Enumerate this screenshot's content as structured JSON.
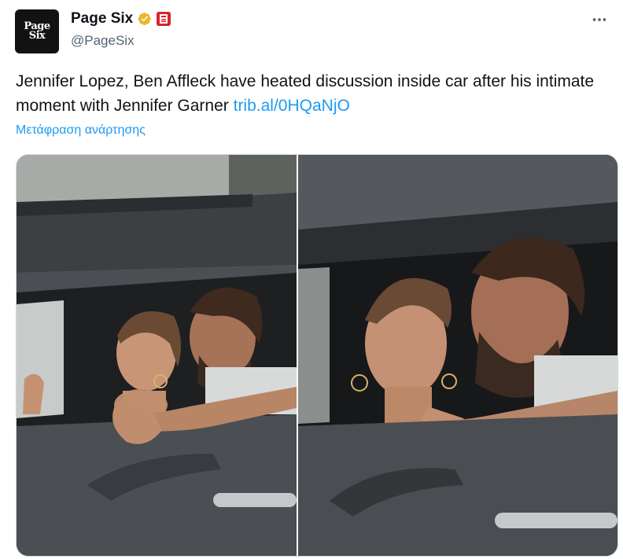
{
  "account": {
    "display_name": "Page Six",
    "handle": "@PageSix",
    "avatar_text_line1": "Page",
    "avatar_text_line2": "Six"
  },
  "tweet": {
    "text": "Jennifer Lopez, Ben Affleck have heated discussion inside car after his intimate moment with Jennifer Garner ",
    "link": "trib.al/0HQaNjO",
    "translate_label": "Μετάφραση ανάρτησης"
  },
  "icons": {
    "verified": "verified-gold-icon",
    "affiliate": "page-six-affiliate-badge",
    "more": "more-options-icon"
  },
  "colors": {
    "link": "#1d9bf0",
    "handle": "#536471",
    "verified": "#e8b829"
  }
}
